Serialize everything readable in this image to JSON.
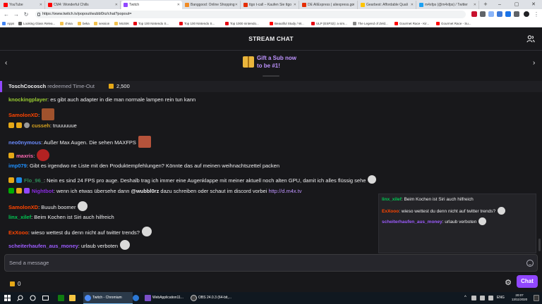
{
  "browser": {
    "tabs": [
      {
        "title": "YouTube",
        "color": "#ff0000"
      },
      {
        "title": "CM4: Wonderful Chills",
        "color": "#ff0000"
      },
      {
        "title": "Twitch",
        "color": "#9147ff",
        "active": true
      },
      {
        "title": "Banggood: Online Shopping",
        "color": "#f08a24"
      },
      {
        "title": "ttgo t-call – Kaufen Sie ttgo",
        "color": "#e62e04"
      },
      {
        "title": "DE AliExpress | aliexpress.go",
        "color": "#e62e04"
      },
      {
        "title": "Gearbest: Affordable Quali",
        "color": "#ffc400"
      },
      {
        "title": "m4xfps (@m4xfps) / Twitter",
        "color": "#1da1f2"
      }
    ],
    "new_tab": "+",
    "window_controls": {
      "minimize": "–",
      "maximize": "▢",
      "close": "✕"
    },
    "url": "https://www.twitch.tv/popout/wubbl0rz/chat?popout=",
    "back": "←",
    "forward": "→",
    "reload": "↻",
    "bookmarks": [
      {
        "label": "Apps",
        "color": "#4285f4"
      },
      {
        "label": "Looking Glass Relea...",
        "color": "#5a5a5a"
      },
      {
        "label": "china",
        "color": "#f2c14e"
      },
      {
        "label": "beka",
        "color": "#f2c14e"
      },
      {
        "label": "session",
        "color": "#f2c14e"
      },
      {
        "label": "MUSIK",
        "color": "#f2c14e"
      },
      {
        "label": "Top 100 Nintendo S...",
        "color": "#e60012"
      },
      {
        "label": "Top 100 Nintendo S...",
        "color": "#e60012"
      },
      {
        "label": "Top 1000 nintendo...",
        "color": "#e60012"
      },
      {
        "label": "Beautiful Study / W...",
        "color": "#ff0000"
      },
      {
        "label": "ULP (ESP32): a sim...",
        "color": "#e60012"
      },
      {
        "label": "The Legend of Zeld...",
        "color": "#888888"
      },
      {
        "label": "Gourmet Race - Kir...",
        "color": "#ff0000"
      },
      {
        "label": "Gourmet Race - Su...",
        "color": "#ff0000"
      }
    ]
  },
  "chat": {
    "title": "STREAM CHAT",
    "prev_arrow": "‹",
    "next_arrow": "›",
    "promo_line1": "Gift a Sub now",
    "promo_line2": "to be #1!",
    "redeem_user": "ToschCocosch",
    "redeem_text": "redeemed Time-Out",
    "redeem_points": "2,500",
    "messages": [
      {
        "user": "knockingplayer",
        "color": "#9acd32",
        "text": ": es gibt auch adapter in die man normale lampen rein tun kann"
      },
      {
        "user": "SamolonXD",
        "color": "#ff4500",
        "text": ":"
      },
      {
        "user": "cusseh",
        "color": "#daa520",
        "text": ": truuuuuue"
      },
      {
        "user": "neo0nymous",
        "color": "#6b8cff",
        "text": ": Außer Max Augen. Die sehen MAXFPS"
      },
      {
        "user": "maxris",
        "color": "#ff69b4",
        "text": ":"
      },
      {
        "user": "imp079",
        "color": "#1e90ff",
        "text": ": Gibt es irgendwo ne Liste mit den Produktempfehlungen? Könnte das auf meinen weihnachtszettel packen"
      },
      {
        "user": "Flo_96_",
        "color": "#2e8b57",
        "text": ": Nein es sind 24 FPS pro auge. Deshalb trag ich immer eine Augenklappe mit meiner aktuell noch alten GPU, damit ich alles flüssig sehe"
      },
      {
        "user": "Nightbot",
        "color": "#8a2be2",
        "text_pre": ": wenn ich etwas übersehe dann",
        "mention": "@wubbl0rz",
        "text_mid": "dazu schreiben oder schaut im discord vorbei",
        "link": "http://d.m4x.tv"
      },
      {
        "user": "SamolonXD",
        "color": "#ff4500",
        "text": ": Buuuh boomer"
      },
      {
        "user": "linx_xilef",
        "color": "#00c853",
        "text": ": Beim Kochen ist Siri auch hilfreich"
      },
      {
        "user": "ExXooo",
        "color": "#ff4500",
        "text": ": wieso wettest du denn nicht auf twitter trends?"
      },
      {
        "user": "scheiterhaufen_aus_money",
        "color": "#9d5cff",
        "text": ": urlaub verboten"
      }
    ],
    "overlay": [
      {
        "user": "linx_xilef",
        "color": "#00c853",
        "text": ": Beim Kochen ist Siri auch hilfreich"
      },
      {
        "user": "ExXooo",
        "color": "#ff4500",
        "text": ": wieso wettest du denn nicht auf twitter trends?"
      },
      {
        "user": "scheiterhaufen_aus_money",
        "color": "#9d5cff",
        "text": ": urlaub verboten"
      }
    ],
    "input_placeholder": "Send a message",
    "bits_count": "0",
    "chat_button": "Chat"
  },
  "taskbar": {
    "apps": [
      {
        "label": "Twitch - Chromium",
        "color": "#4c8bf5",
        "active": true
      },
      {
        "label": "",
        "color": "#2b78d6"
      },
      {
        "label": "WebApplication11...",
        "color": "#7a4fc9"
      },
      {
        "label": "OBS 24.0.3 (64-bit,...",
        "color": "#444444"
      }
    ],
    "tray": "ENG",
    "time": "20:07",
    "date": "13/11/2020"
  },
  "colors": {
    "accent": "#9147ff",
    "background": "#18181b",
    "text": "#efeff1"
  }
}
